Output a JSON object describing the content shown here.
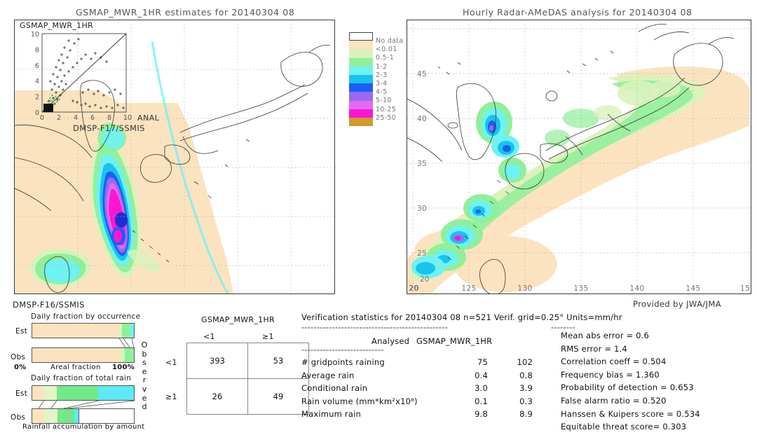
{
  "left_panel": {
    "title": "GSMAP_MWR_1HR estimates for 20140304 08",
    "inset_label": "GSMAP_MWR_1HR",
    "anal_label": "ANAL",
    "sensor_label": "DMSP-F17/SSMIS",
    "scatter": {
      "x_ticks": [
        "0",
        "2",
        "4",
        "6",
        "8",
        "10"
      ],
      "y_ticks": [
        "0",
        "2",
        "4",
        "6",
        "8",
        "10"
      ],
      "xlim": [
        0,
        10
      ],
      "ylim": [
        0,
        10
      ]
    }
  },
  "right_panel": {
    "title": "Hourly Radar-AMeDAS analysis for 20140304 08",
    "provider": "Provided by JWA/JMA",
    "x_ticks": [
      "120",
      "125",
      "130",
      "135",
      "140",
      "145",
      "15"
    ],
    "y_ticks": [
      "45",
      "40",
      "35",
      "30",
      "25",
      "20"
    ],
    "corner_lat": "20"
  },
  "colorbar": {
    "labels": [
      "No data",
      "<0.01",
      "0.5-1",
      "1-2",
      "2-3",
      "3-4",
      "4-5",
      "5-10",
      "10-25",
      "25-50"
    ],
    "colors": [
      "#ffffff",
      "#f7debc",
      "#d6f2b8",
      "#8ef09a",
      "#6ef2f2",
      "#18c3ec",
      "#1b5ef5",
      "#9a6af2",
      "#e06cf0",
      "#ff14d4",
      "#d09a2c"
    ]
  },
  "fractions": {
    "sensor_label": "DMSP-F16/SSMIS",
    "occurrence_title": "Daily fraction by occurrence",
    "total_rain_title": "Daily fraction of total rain",
    "axis_left": "0%",
    "axis_center": "Areal fraction",
    "axis_right": "100%",
    "bottom_caption": "Rainfall accumulation by amount",
    "row_est": "Est",
    "row_obs": "Obs",
    "occurrence_est": [
      {
        "color": "#fbe3bf",
        "pct": 85.0
      },
      {
        "color": "#d9f2bc",
        "pct": 3.5
      },
      {
        "color": "#8ef09a",
        "pct": 8.0
      },
      {
        "color": "#6ef2f2",
        "pct": 3.5
      }
    ],
    "occurrence_obs": [
      {
        "color": "#fbe3bf",
        "pct": 87.0
      },
      {
        "color": "#d9f2bc",
        "pct": 4.0
      },
      {
        "color": "#8ef09a",
        "pct": 9.0
      }
    ],
    "total_est": [
      {
        "color": "#fbe3bf",
        "pct": 12.0
      },
      {
        "color": "#e2f5c6",
        "pct": 12.0
      },
      {
        "color": "#71e98a",
        "pct": 41.0
      },
      {
        "color": "#5fe9f5",
        "pct": 35.0
      }
    ],
    "total_obs": [
      {
        "color": "#fbe3bf",
        "pct": 12.5
      },
      {
        "color": "#e2f5c6",
        "pct": 12.5
      },
      {
        "color": "#71e98a",
        "pct": 17.0
      },
      {
        "color": "#5fe9f5",
        "pct": 4.0
      }
    ]
  },
  "contingency": {
    "model_label": "GSMAP_MWR_1HR",
    "col_headers": [
      "<1",
      "≥1"
    ],
    "row_headers": [
      "<1",
      "≥1"
    ],
    "observed_label": "Observed",
    "cells": [
      [
        "393",
        "53"
      ],
      [
        "26",
        "49"
      ]
    ]
  },
  "verification": {
    "header": "Verification statistics for 20140304 08  n=521  Verif. grid=0.25°  Units=mm/hr",
    "dash_long": "------------------------------------------------",
    "col_analysed": "Analysed",
    "col_model": "GSMAP_MWR_1HR",
    "dash_short": "---------------------------",
    "rows": [
      {
        "name": "# gridpoints raining",
        "analysed": "75",
        "model": "102"
      },
      {
        "name": "Average rain",
        "analysed": "0.4",
        "model": "0.8"
      },
      {
        "name": "Conditional rain",
        "analysed": "3.0",
        "model": "3.9"
      },
      {
        "name": "Rain volume (mm*km²x10⁸)",
        "analysed": "0.1",
        "model": "0.3"
      },
      {
        "name": "Maximum rain",
        "analysed": "9.8",
        "model": "8.9"
      }
    ],
    "scores_dash": "--------",
    "scores": [
      "Mean abs error = 0.6",
      "RMS error = 1.4",
      "Correlation coeff = 0.504",
      "Frequency bias = 1.360",
      "Probability of detection = 0.653",
      "False alarm ratio = 0.520",
      "Hanssen & Kuipers score = 0.534",
      "Equitable threat score= 0.303"
    ]
  }
}
